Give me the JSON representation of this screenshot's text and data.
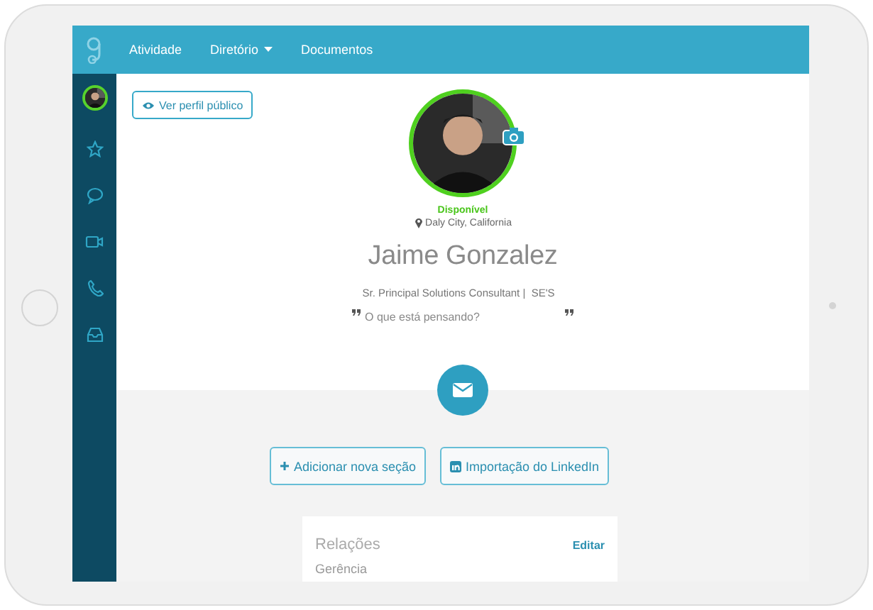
{
  "nav": {
    "items": [
      {
        "label": "Atividade",
        "has_menu": false
      },
      {
        "label": "Diretório",
        "has_menu": true
      },
      {
        "label": "Documentos",
        "has_menu": false
      }
    ]
  },
  "profile": {
    "public_button": "Ver perfil público",
    "status": "Disponível",
    "location": "Daly City, California",
    "name": "Jaime Gonzalez",
    "title": "Sr. Principal Solutions Consultant |  SE'S",
    "quote": {
      "placeholder": "O que está pensando?"
    }
  },
  "actions": [
    {
      "kind": "add",
      "label": "Adicionar nova seção"
    },
    {
      "kind": "linkedin",
      "label": "Importação do LinkedIn"
    }
  ],
  "card": {
    "title": "Relações",
    "action": "Editar",
    "items": [
      "Gerência"
    ]
  }
}
